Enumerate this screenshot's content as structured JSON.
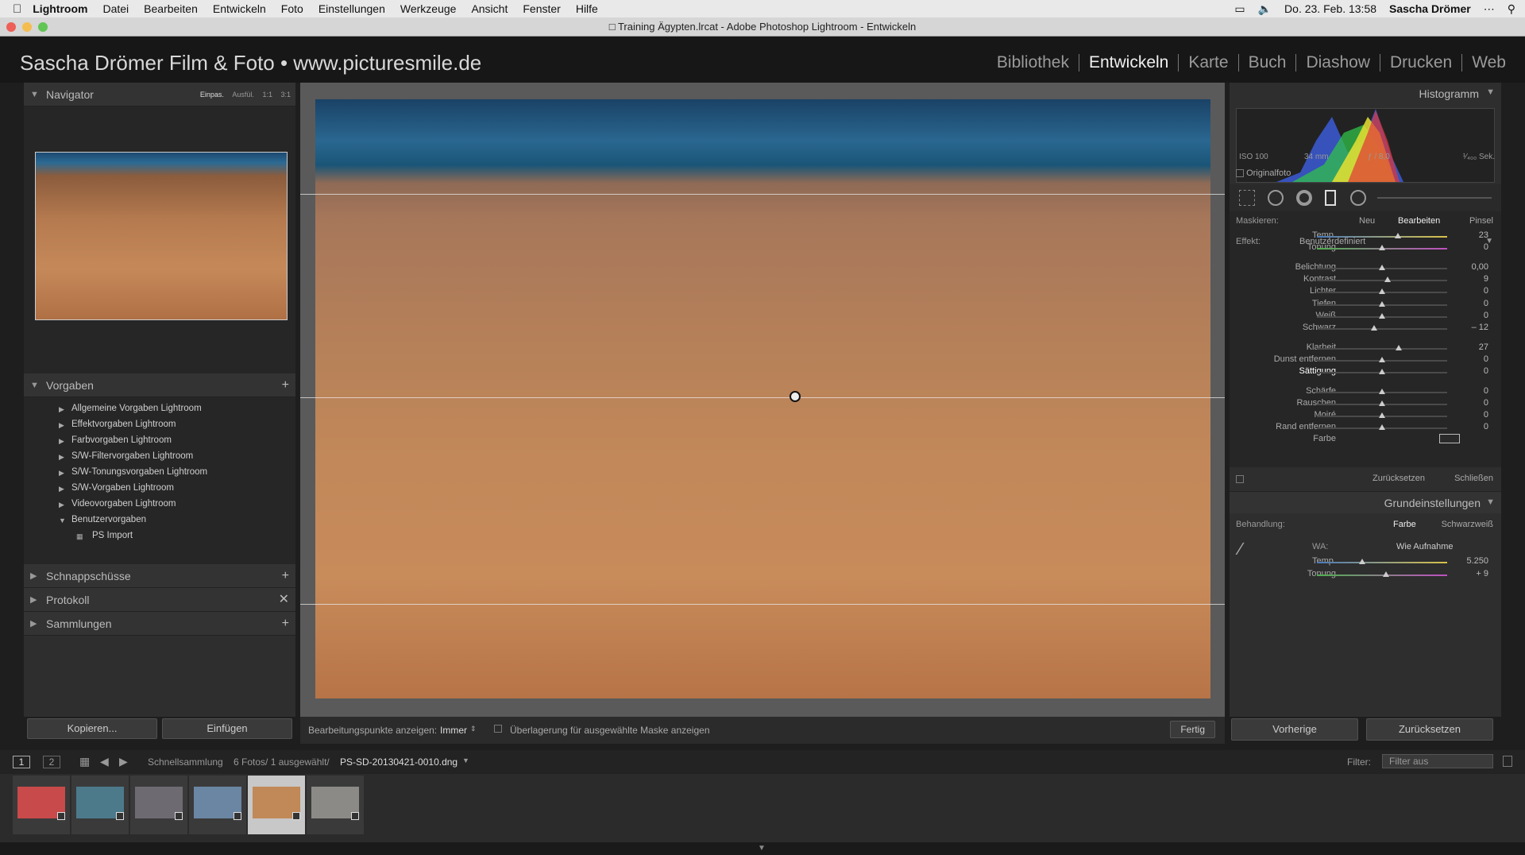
{
  "menubar": {
    "items": [
      "Lightroom",
      "Datei",
      "Bearbeiten",
      "Entwickeln",
      "Foto",
      "Einstellungen",
      "Werkzeuge",
      "Ansicht",
      "Fenster",
      "Hilfe"
    ],
    "datetime": "Do. 23. Feb. 13:58",
    "user": "Sascha Drömer"
  },
  "window": {
    "title": "Training Ägypten.lrcat - Adobe Photoshop Lightroom - Entwickeln"
  },
  "identity": {
    "brand": "Sascha Drömer Film & Foto • www.picturesmile.de",
    "modules": [
      "Bibliothek",
      "Entwickeln",
      "Karte",
      "Buch",
      "Diashow",
      "Drucken",
      "Web"
    ],
    "active_module": "Entwickeln"
  },
  "left": {
    "navigator": {
      "title": "Navigator",
      "options": [
        "Einpas.",
        "Ausfül.",
        "1:1",
        "3:1"
      ]
    },
    "presets": {
      "title": "Vorgaben",
      "folders": [
        "Allgemeine Vorgaben Lightroom",
        "Effektvorgaben Lightroom",
        "Farbvorgaben Lightroom",
        "S/W-Filtervorgaben Lightroom",
        "S/W-Tonungsvorgaben Lightroom",
        "S/W-Vorgaben Lightroom",
        "Videovorgaben Lightroom",
        "Benutzervorgaben"
      ],
      "user_item": "PS Import"
    },
    "snapshots": "Schnappschüsse",
    "history": "Protokoll",
    "collections": "Sammlungen",
    "copy_label": "Kopieren...",
    "paste_label": "Einfügen"
  },
  "toolbar": {
    "pins_label": "Bearbeitungspunkte anzeigen:",
    "pins_value": "Immer",
    "overlay_label": "Überlagerung für ausgewählte Maske anzeigen",
    "done_label": "Fertig"
  },
  "right": {
    "histogram": {
      "title": "Histogramm",
      "iso": "ISO 100",
      "focal": "34 mm",
      "aperture": "ƒ / 8,0",
      "shutter": "¹⁄₄₀₀ Sek."
    },
    "original_label": "Originalfoto",
    "mask": {
      "label": "Maskieren:",
      "new": "Neu",
      "edit": "Bearbeiten",
      "brush": "Pinsel"
    },
    "effect": {
      "label": "Effekt:",
      "value": "Benutzerdefiniert"
    },
    "sliders": [
      {
        "label": "Temp.",
        "value": "23",
        "pos": 0.62
      },
      {
        "label": "Tonung",
        "value": "0",
        "pos": 0.5
      },
      {
        "label": "Belichtung",
        "value": "0,00",
        "pos": 0.5
      },
      {
        "label": "Kontrast",
        "value": "9",
        "pos": 0.54
      },
      {
        "label": "Lichter",
        "value": "0",
        "pos": 0.5
      },
      {
        "label": "Tiefen",
        "value": "0",
        "pos": 0.5
      },
      {
        "label": "Weiß",
        "value": "0",
        "pos": 0.5
      },
      {
        "label": "Schwarz",
        "value": "– 12",
        "pos": 0.44
      },
      {
        "label": "Klarheit",
        "value": "27",
        "pos": 0.63
      },
      {
        "label": "Dunst entfernen",
        "value": "0",
        "pos": 0.5
      },
      {
        "label": "Sättigung",
        "value": "0",
        "pos": 0.5
      },
      {
        "label": "Schärfe",
        "value": "0",
        "pos": 0.5
      },
      {
        "label": "Rauschen",
        "value": "0",
        "pos": 0.5
      },
      {
        "label": "Moiré",
        "value": "0",
        "pos": 0.5
      },
      {
        "label": "Rand entfernen",
        "value": "0",
        "pos": 0.5
      }
    ],
    "color_label": "Farbe",
    "reset_label": "Zurücksetzen",
    "close_label": "Schließen",
    "basic": {
      "title": "Grundeinstellungen",
      "treatment_label": "Behandlung:",
      "color": "Farbe",
      "bw": "Schwarzweiß",
      "wb_label": "WA:",
      "wb_value": "Wie Aufnahme",
      "temp_label": "Temp.",
      "temp_value": "5.250",
      "temp_pos": 0.35,
      "tint_label": "Tonung",
      "tint_value": "+ 9",
      "tint_pos": 0.53
    },
    "prev_label": "Vorherige",
    "reset2_label": "Zurücksetzen"
  },
  "filmstrip": {
    "views": [
      "1",
      "2"
    ],
    "source": "Schnellsammlung",
    "count": "6 Fotos/ 1 ausgewählt/",
    "filename": "PS-SD-20130421-0010.dng",
    "filter_label": "Filter:",
    "filter_value": "Filter aus",
    "thumb_colors": [
      "#c94a4a",
      "#4c7a8a",
      "#6d6a72",
      "#6b86a3",
      "#c08957",
      "#8c8a86"
    ],
    "selected_index": 4
  },
  "colors": {
    "accent": "#f0f0f0",
    "panel": "#2e2e2e",
    "menubar": "#e9e9e9"
  }
}
